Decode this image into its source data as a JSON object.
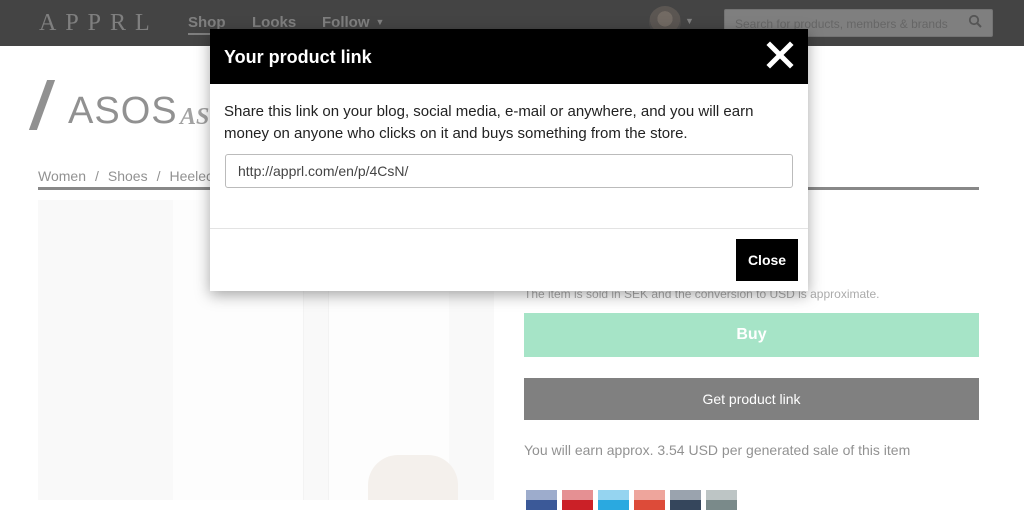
{
  "nav": {
    "logo": "APPRL",
    "items": [
      {
        "label": "Shop",
        "active": true
      },
      {
        "label": "Looks"
      },
      {
        "label": "Follow",
        "has_dropdown": true
      }
    ],
    "search": {
      "placeholder": "Search for products, members & brands"
    },
    "avatar_icon": "avatar-photo",
    "icons": {
      "search": "search-icon",
      "dropdown": "caret-down-icon"
    }
  },
  "product": {
    "brand": "ASOS",
    "brand_subtitle": "AS",
    "breadcrumb": [
      "Women",
      "Shoes",
      "Heelec"
    ],
    "conversion_note": "The item is sold in SEK and the conversion to USD is approximate.",
    "buy_label": "Buy",
    "get_link_label": "Get product link",
    "earn_text": "You will earn approx. 3.54 USD per generated sale of this item",
    "social_icons": [
      "facebook-icon",
      "pinterest-icon",
      "twitter-icon",
      "google-plus-icon",
      "tumblr-icon",
      "email-icon"
    ],
    "colors": {
      "buy": "#4cc98f",
      "dark": "#000000"
    }
  },
  "modal": {
    "title": "Your product link",
    "body": "Share this link on your blog, social media, e-mail or anywhere, and you will earn money on anyone who clicks on it and buys something from the store.",
    "link_value": "http://apprl.com/en/p/4CsN/",
    "close_label": "Close",
    "close_icon": "close-x-icon"
  }
}
